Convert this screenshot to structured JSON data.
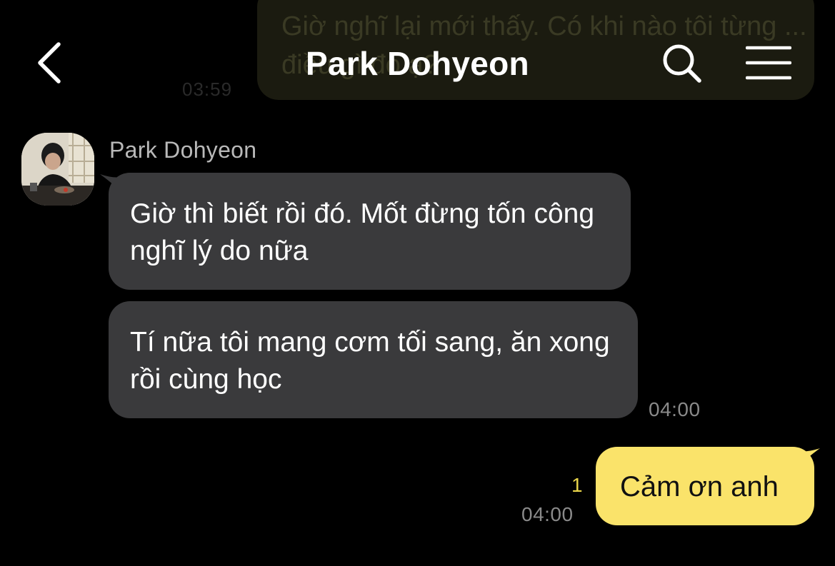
{
  "header": {
    "title": "Park Dohyeon",
    "back_icon": "chevron-left-icon",
    "search_icon": "search-icon",
    "menu_icon": "hamburger-menu-icon"
  },
  "previous_message": {
    "text": "Giờ nghĩ lại mới thấy. Có khi nào tôi từng ... điều gì đó ạ?",
    "time": "03:59"
  },
  "incoming": {
    "sender": "Park Dohyeon",
    "messages": [
      {
        "text": "Giờ thì biết rồi đó. Mốt đừng tốn công nghĩ lý do nữa"
      },
      {
        "text": "Tí nữa tôi mang cơm tối sang, ăn xong rồi cùng học"
      }
    ],
    "time": "04:00"
  },
  "outgoing": {
    "text": "Cảm ơn anh",
    "unread_count": "1",
    "time": "04:00"
  },
  "colors": {
    "background": "#000000",
    "incoming_bubble": "#3a3a3c",
    "outgoing_bubble": "#fae36a",
    "unread": "#e9d54a"
  }
}
